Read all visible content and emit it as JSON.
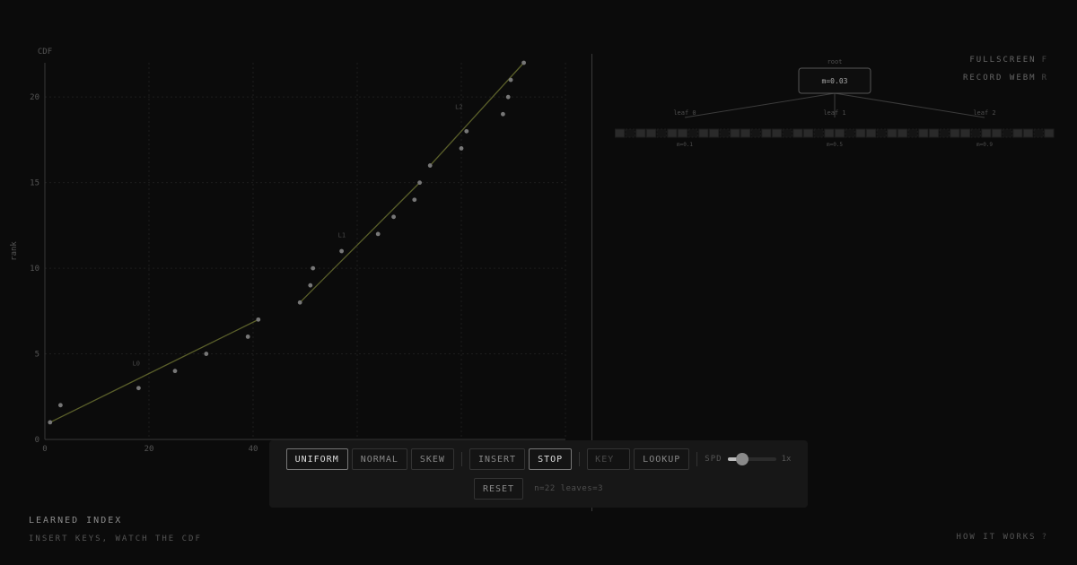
{
  "header": {
    "fullscreen_label": "FULLSCREEN",
    "fullscreen_key": "F",
    "record_label": "RECORD WEBM",
    "record_key": "R"
  },
  "footer": {
    "title": "LEARNED INDEX",
    "subtitle": "INSERT KEYS, WATCH THE CDF",
    "how_label": "HOW IT WORKS",
    "how_key": "?"
  },
  "controls": {
    "distribution_buttons": [
      {
        "label": "UNIFORM",
        "active": true
      },
      {
        "label": "NORMAL",
        "active": false
      },
      {
        "label": "SKEW",
        "active": false
      }
    ],
    "insert_label": "INSERT",
    "stop_label": "STOP",
    "key_placeholder": "KEY",
    "key_value": "",
    "lookup_label": "LOOKUP",
    "speed_label": "SPD",
    "speed_value": "1x",
    "speed_fraction": 0.3,
    "reset_label": "RESET",
    "status_text": "n=22 leaves=3"
  },
  "tree": {
    "root_label": "root",
    "root_value": "m=0.03",
    "leaves": [
      {
        "label": "leaf 0",
        "value": "m=0.1"
      },
      {
        "label": "leaf 1",
        "value": "m=0.5"
      },
      {
        "label": "leaf 2",
        "value": "m=0.9"
      }
    ],
    "keys_track_count": 42
  },
  "chart_data": {
    "type": "scatter",
    "ylabel": "CDF",
    "y_side_label": "rank",
    "xlabel": "",
    "xlim": [
      0,
      100
    ],
    "ylim": [
      0,
      22
    ],
    "xticks": [
      0,
      20,
      40
    ],
    "yticks": [
      0,
      5,
      10,
      15,
      20
    ],
    "grid": true,
    "series": [
      {
        "x": [
          1,
          3,
          18,
          25,
          31,
          39,
          41,
          49,
          51,
          51.5,
          57,
          64,
          67,
          71,
          72,
          74,
          80,
          81,
          88,
          89,
          89.5,
          92
        ],
        "y": [
          1,
          2,
          3,
          4,
          5,
          6,
          7,
          8,
          9,
          10,
          11,
          12,
          13,
          14,
          15,
          16,
          17,
          18,
          19,
          20,
          21,
          22
        ]
      }
    ],
    "segments": [
      {
        "label": "L0",
        "x0": 1,
        "y0": 1,
        "x1": 41,
        "y1": 7
      },
      {
        "label": "L1",
        "x0": 49,
        "y0": 8,
        "x1": 72,
        "y1": 15
      },
      {
        "label": "L2",
        "x0": 74,
        "y0": 16,
        "x1": 92,
        "y1": 22
      }
    ]
  },
  "colors": {
    "background": "#0b0b0b",
    "segment_line": "#5a5f2a",
    "point": "#777777",
    "grid": "#1d1d1d",
    "axis": "#3a3a3a"
  }
}
